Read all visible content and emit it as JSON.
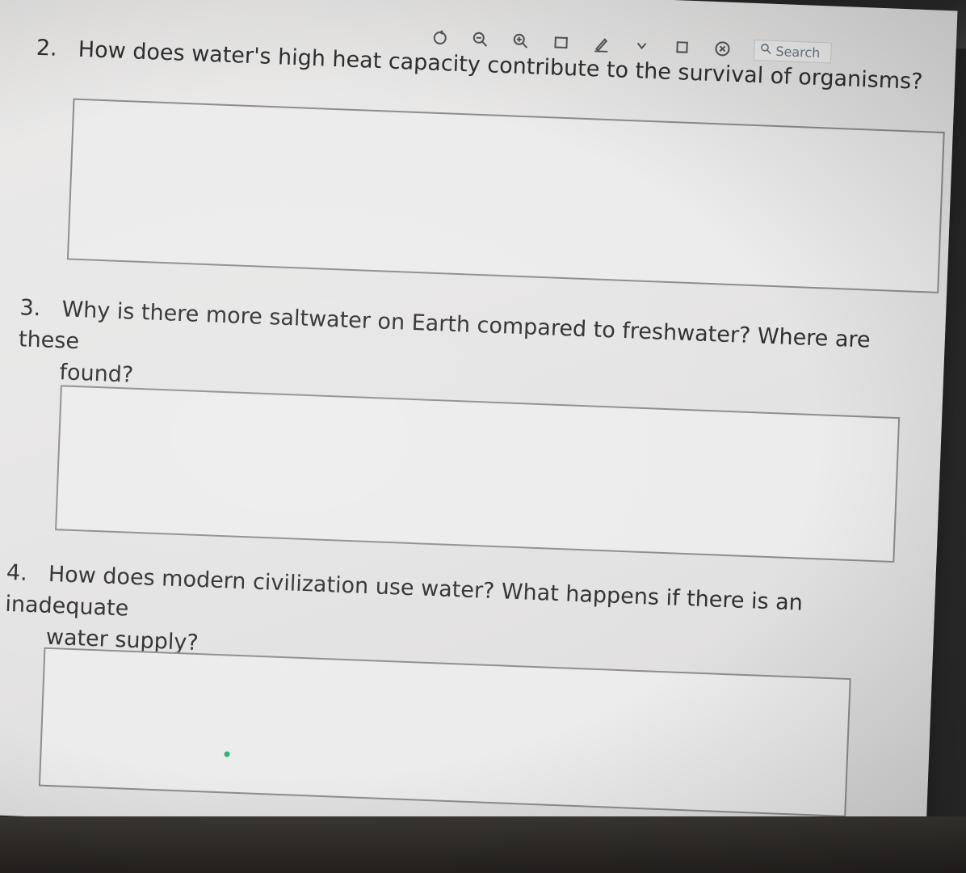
{
  "toolbar": {
    "icons": [
      "rotate-icon",
      "zoom-out-icon",
      "zoom-in-icon",
      "page-icon",
      "pen-icon",
      "chevron-down-icon",
      "square-icon",
      "close-circle-icon"
    ],
    "search_placeholder": "Search"
  },
  "questions": [
    {
      "number": "2.",
      "text": "How does water's high heat capacity contribute to the survival of organisms?",
      "answer": ""
    },
    {
      "number": "3.",
      "text_line1": "Why is there more saltwater on Earth compared to freshwater? Where are these",
      "text_line2": "found?",
      "answer": ""
    },
    {
      "number": "4.",
      "text_line1": "How does modern civilization use water? What happens if there is an inadequate",
      "text_line2": "water supply?",
      "answer": ""
    }
  ],
  "colors": {
    "page_background": "#e8e7e6",
    "text": "#2f2f2f",
    "box_border": "#8d8d8d",
    "search_text": "#6b7a88"
  }
}
